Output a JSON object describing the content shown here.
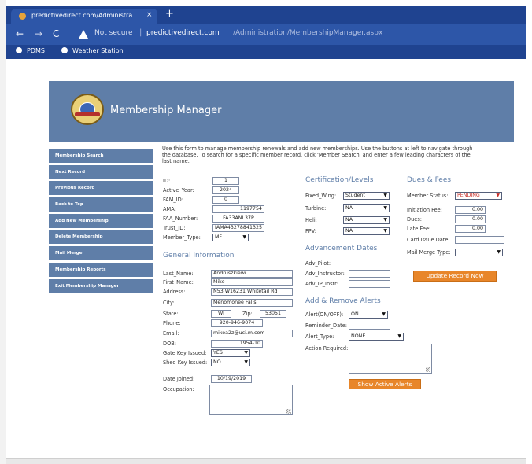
{
  "browser": {
    "tab_title": "predictivedirect.com/Administra",
    "tab_close": "×",
    "new_tab": "+",
    "nav_back": "←",
    "nav_forward": "→",
    "nav_reload": "C",
    "not_secure": "Not secure",
    "url_host": "predictivedirect.com",
    "url_path": "/Administration/MembershipManager.aspx",
    "bookmarks": [
      "PDMS",
      "Weather Station"
    ]
  },
  "site": {
    "title": "Membership Manager"
  },
  "sidebar": {
    "items": [
      "Membership Search",
      "Next Record",
      "Previous Record",
      "Back to Top",
      "Add New Membership",
      "Delete Membership",
      "Mail Merge",
      "Membership Reports",
      "Exit Membership Manager"
    ]
  },
  "intro": "Use this form to manage membership renewals and add new memberships. Use the buttons at left to navigate through the database. To search for a specific member record, click 'Member Search' and enter a few leading characters of the last name.",
  "record": {
    "id_label": "ID:",
    "id": "1",
    "active_year_label": "Active_Year:",
    "active_year": "2024",
    "fam_id_label": "FAM_ID:",
    "fam_id": "0",
    "ama_label": "AMA:",
    "ama": "1197754",
    "faa_label": "FAA_Number:",
    "faa": "FA33ANL37P",
    "trust_label": "Trust_ID:",
    "trust": "IAMA43278841325",
    "member_type_label": "Member_Type:",
    "member_type": "MF"
  },
  "general": {
    "heading": "General Information",
    "last_name_label": "Last_Name:",
    "last_name": "Andruszkiewi",
    "first_name_label": "First_Name:",
    "first_name": "Mike",
    "address_label": "Address:",
    "address": "N53 W16231 Whitetail Rd",
    "city_label": "City:",
    "city": "Menomonee Falls",
    "state_label": "State:",
    "state": "WI",
    "zip_label": "Zip:",
    "zip": "53051",
    "phone_label": "Phone:",
    "phone": "920-946-9074",
    "email_label": "Email:",
    "email": "mikea2z@uci.m.com",
    "dob_label": "DOB:",
    "dob": "1954-10",
    "gate_key_label": "Gate Key Issued:",
    "gate_key": "YES",
    "shed_key_label": "Shed Key Issued:",
    "shed_key": "NO",
    "date_joined_label": "Date Joined:",
    "date_joined": "10/19/2019",
    "occupation_label": "Occupation:"
  },
  "certification": {
    "heading": "Certification/Levels",
    "fixed_wing_label": "Fixed_Wing:",
    "fixed_wing": "Student",
    "turbine_label": "Turbine:",
    "turbine": "NA",
    "heli_label": "Heli:",
    "heli": "NA",
    "fpv_label": "FPV:",
    "fpv": "NA"
  },
  "advancement": {
    "heading": "Advancement Dates",
    "pilot_label": "Adv_Pilot:",
    "instructor_label": "Adv_Instructor:",
    "ip_instr_label": "Adv_IP_Instr:"
  },
  "alerts": {
    "heading": "Add & Remove Alerts",
    "alert_label": "Alert(ON/OFF):",
    "alert": "ON",
    "reminder_label": "Reminder_Date:",
    "alert_type_label": "Alert_Type:",
    "alert_type": "NONE",
    "action_label": "Action Required:",
    "show_button": "Show Active Alerts"
  },
  "dues": {
    "heading": "Dues & Fees",
    "status_label": "Member Status:",
    "status": "PENDING",
    "initiation_label": "Initiation Fee:",
    "initiation": "0.00",
    "dues_label": "Dues:",
    "dues": "0.00",
    "late_fee_label": "Late Fee:",
    "late_fee": "0.00",
    "card_issue_label": "Card Issue Date:",
    "mail_merge_label": "Mail Merge Type:",
    "update_button": "Update Record Now"
  },
  "colors": {
    "brand": "#5f7ea8",
    "accent": "#e8862a",
    "browser": "#1f4390",
    "alert": "#c8302a"
  }
}
